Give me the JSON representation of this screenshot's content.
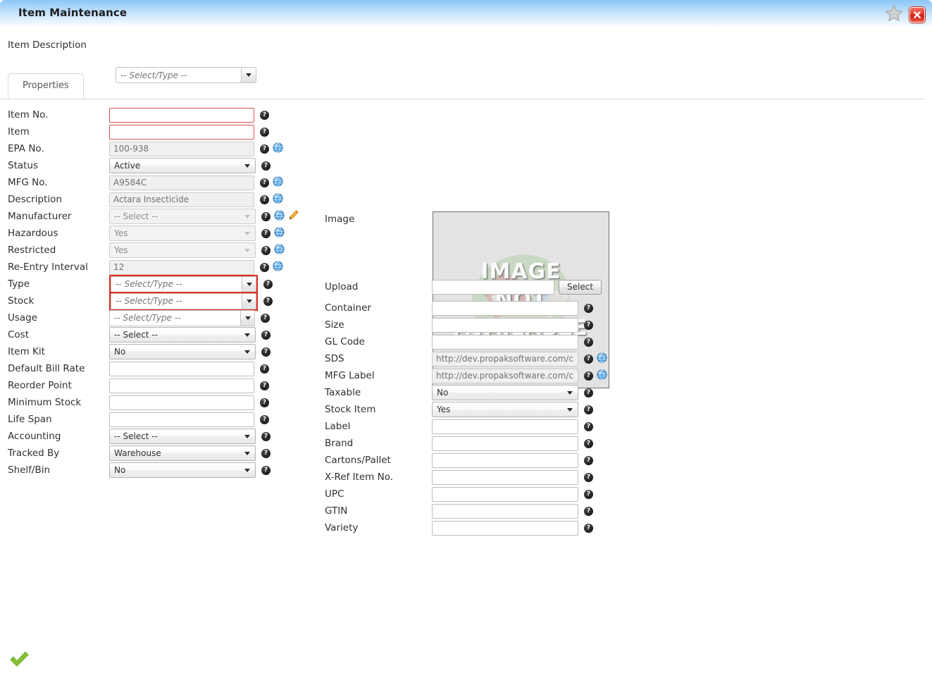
{
  "window": {
    "title": "Item Maintenance",
    "star_icon": "star-icon",
    "close_icon": "close-icon",
    "accent_blue": "#8ac5f8",
    "close_red": "#e23c2c"
  },
  "header": {
    "item_description_label": "Item Description",
    "item_description_value": "",
    "item_description_placeholder": "-- Select/Type --"
  },
  "tabs": [
    {
      "label": "Properties",
      "active": true
    }
  ],
  "image_panel": {
    "label": "Image",
    "placeholder_line1": "IMAGE",
    "placeholder_line2": "NOT",
    "placeholder_line3": "AVAILABLE"
  },
  "upload": {
    "label": "Upload",
    "value": "",
    "button_label": "Select"
  },
  "left_fields": [
    {
      "label": "Item No.",
      "type": "text",
      "value": "",
      "placeholder": "",
      "state": "error",
      "help": true,
      "globe": false,
      "pencil": false
    },
    {
      "label": "Item",
      "type": "text",
      "value": "",
      "placeholder": "",
      "state": "error",
      "help": true,
      "globe": false,
      "pencil": false
    },
    {
      "label": "EPA No.",
      "type": "text",
      "value": "100-938",
      "placeholder": "",
      "state": "disabled",
      "help": true,
      "globe": true,
      "pencil": false
    },
    {
      "label": "Status",
      "type": "select",
      "value": "Active",
      "placeholder": "",
      "state": "enabled",
      "help": true,
      "globe": false,
      "pencil": false
    },
    {
      "label": "MFG No.",
      "type": "text",
      "value": "A9584C",
      "placeholder": "",
      "state": "disabled",
      "help": true,
      "globe": true,
      "pencil": false
    },
    {
      "label": "Description",
      "type": "text",
      "value": "Actara Insecticide",
      "placeholder": "",
      "state": "disabled",
      "help": true,
      "globe": true,
      "pencil": false
    },
    {
      "label": "Manufacturer",
      "type": "select",
      "value": "-- Select --",
      "placeholder": "",
      "state": "disabled",
      "help": true,
      "globe": true,
      "pencil": true
    },
    {
      "label": "Hazardous",
      "type": "select",
      "value": "Yes",
      "placeholder": "",
      "state": "disabled",
      "help": true,
      "globe": true,
      "pencil": false
    },
    {
      "label": "Restricted",
      "type": "select",
      "value": "Yes",
      "placeholder": "",
      "state": "disabled",
      "help": true,
      "globe": true,
      "pencil": false
    },
    {
      "label": "Re-Entry Interval",
      "type": "text",
      "value": "12",
      "placeholder": "",
      "state": "disabled",
      "help": true,
      "globe": true,
      "pencil": false
    },
    {
      "label": "Type",
      "type": "combo",
      "value": "",
      "placeholder": "-- Select/Type --",
      "state": "error",
      "help": true,
      "globe": false,
      "pencil": false
    },
    {
      "label": "Stock",
      "type": "combo",
      "value": "",
      "placeholder": "-- Select/Type --",
      "state": "error",
      "help": true,
      "globe": false,
      "pencil": false
    },
    {
      "label": "Usage",
      "type": "combo",
      "value": "",
      "placeholder": "-- Select/Type --",
      "state": "enabled",
      "help": true,
      "globe": false,
      "pencil": false
    },
    {
      "label": "Cost",
      "type": "select",
      "value": "-- Select --",
      "placeholder": "",
      "state": "enabled",
      "help": true,
      "globe": false,
      "pencil": false
    },
    {
      "label": "Item Kit",
      "type": "select",
      "value": "No",
      "placeholder": "",
      "state": "enabled",
      "help": true,
      "globe": false,
      "pencil": false
    },
    {
      "label": "Default Bill Rate",
      "type": "text",
      "value": "",
      "placeholder": "",
      "state": "enabled",
      "help": true,
      "globe": false,
      "pencil": false
    },
    {
      "label": "Reorder Point",
      "type": "text",
      "value": "",
      "placeholder": "",
      "state": "enabled",
      "help": true,
      "globe": false,
      "pencil": false
    },
    {
      "label": "Minimum Stock",
      "type": "text",
      "value": "",
      "placeholder": "",
      "state": "enabled",
      "help": true,
      "globe": false,
      "pencil": false
    },
    {
      "label": "Life Span",
      "type": "text",
      "value": "",
      "placeholder": "",
      "state": "enabled",
      "help": true,
      "globe": false,
      "pencil": false
    },
    {
      "label": "Accounting",
      "type": "select",
      "value": "-- Select --",
      "placeholder": "",
      "state": "enabled",
      "help": true,
      "globe": false,
      "pencil": false
    },
    {
      "label": "Tracked By",
      "type": "select",
      "value": "Warehouse",
      "placeholder": "",
      "state": "enabled",
      "help": true,
      "globe": false,
      "pencil": false
    },
    {
      "label": "Shelf/Bin",
      "type": "select",
      "value": "No",
      "placeholder": "",
      "state": "enabled",
      "help": true,
      "globe": false,
      "pencil": false
    }
  ],
  "right_fields": [
    {
      "label": "Container",
      "type": "text",
      "value": "",
      "state": "enabled",
      "help": true,
      "globe": false
    },
    {
      "label": "Size",
      "type": "text",
      "value": "",
      "state": "enabled",
      "help": true,
      "globe": false
    },
    {
      "label": "GL Code",
      "type": "text",
      "value": "",
      "state": "enabled",
      "help": true,
      "globe": false
    },
    {
      "label": "SDS",
      "type": "text",
      "value": "http://dev.propaksoftware.com/che",
      "state": "disabled",
      "help": true,
      "globe": true
    },
    {
      "label": "MFG Label",
      "type": "text",
      "value": "http://dev.propaksoftware.com/che",
      "state": "disabled",
      "help": true,
      "globe": true
    },
    {
      "label": "Taxable",
      "type": "select",
      "value": "No",
      "state": "enabled",
      "help": true,
      "globe": false
    },
    {
      "label": "Stock Item",
      "type": "select",
      "value": "Yes",
      "state": "enabled",
      "help": true,
      "globe": false
    },
    {
      "label": "Label",
      "type": "text",
      "value": "",
      "state": "enabled",
      "help": true,
      "globe": false
    },
    {
      "label": "Brand",
      "type": "text",
      "value": "",
      "state": "enabled",
      "help": true,
      "globe": false
    },
    {
      "label": "Cartons/Pallet",
      "type": "text",
      "value": "",
      "state": "enabled",
      "help": true,
      "globe": false
    },
    {
      "label": "X-Ref Item No.",
      "type": "text",
      "value": "",
      "state": "enabled",
      "help": true,
      "globe": false
    },
    {
      "label": "UPC",
      "type": "text",
      "value": "",
      "state": "enabled",
      "help": true,
      "globe": false
    },
    {
      "label": "GTIN",
      "type": "text",
      "value": "",
      "state": "enabled",
      "help": true,
      "globe": false
    },
    {
      "label": "Variety",
      "type": "text",
      "value": "",
      "state": "enabled",
      "help": true,
      "globe": false
    }
  ],
  "footer": {
    "save_icon": "green-check-icon"
  },
  "icons": {
    "help_glyph": "?",
    "help_name": "help-icon",
    "globe_name": "globe-icon",
    "pencil_name": "edit-pencil-icon"
  }
}
